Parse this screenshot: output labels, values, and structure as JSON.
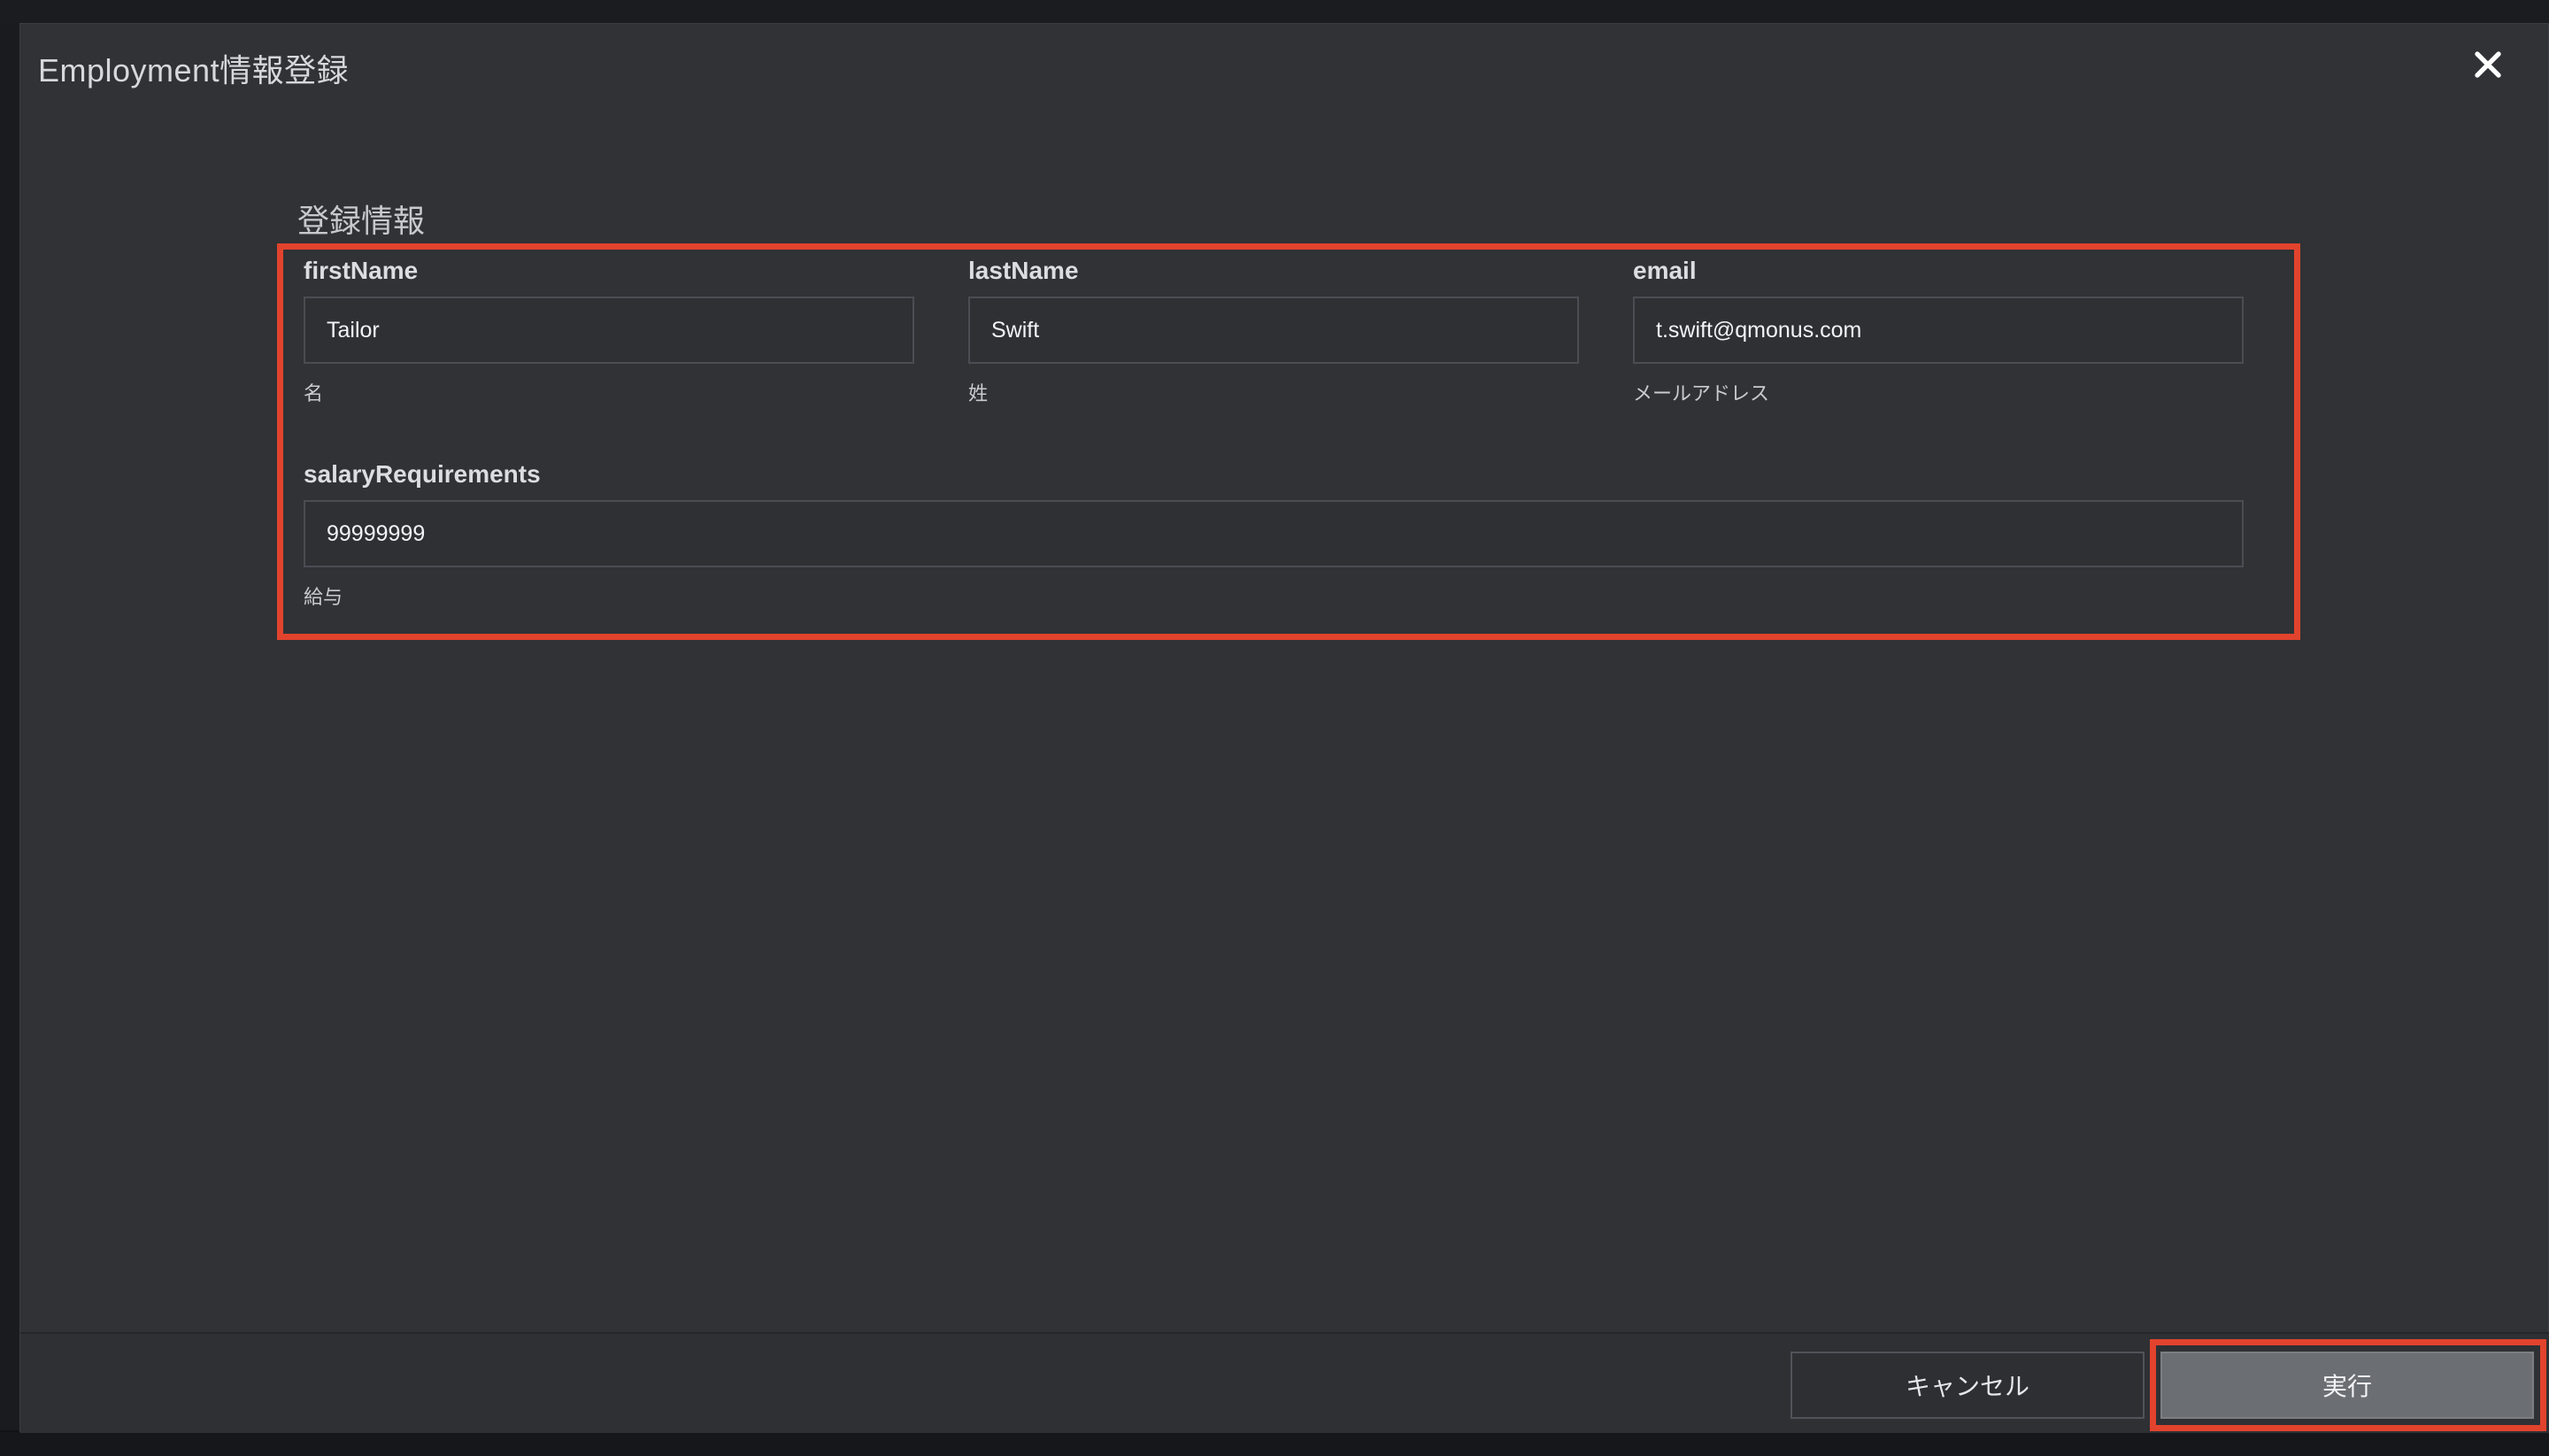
{
  "dialog": {
    "title": "Employment情報登録",
    "close_icon": "close-icon"
  },
  "form": {
    "section_title": "登録情報",
    "fields": [
      {
        "label": "firstName",
        "value": "Tailor",
        "hint": "名"
      },
      {
        "label": "lastName",
        "value": "Swift",
        "hint": "姓"
      },
      {
        "label": "email",
        "value": "t.swift@qmonus.com",
        "hint": "メールアドレス"
      },
      {
        "label": "salaryRequirements",
        "value": "99999999",
        "hint": "給与"
      }
    ]
  },
  "footer": {
    "cancel_label": "キャンセル",
    "run_label": "実行"
  },
  "colors": {
    "highlight": "#e2432d",
    "dialog_bg": "#303236"
  }
}
